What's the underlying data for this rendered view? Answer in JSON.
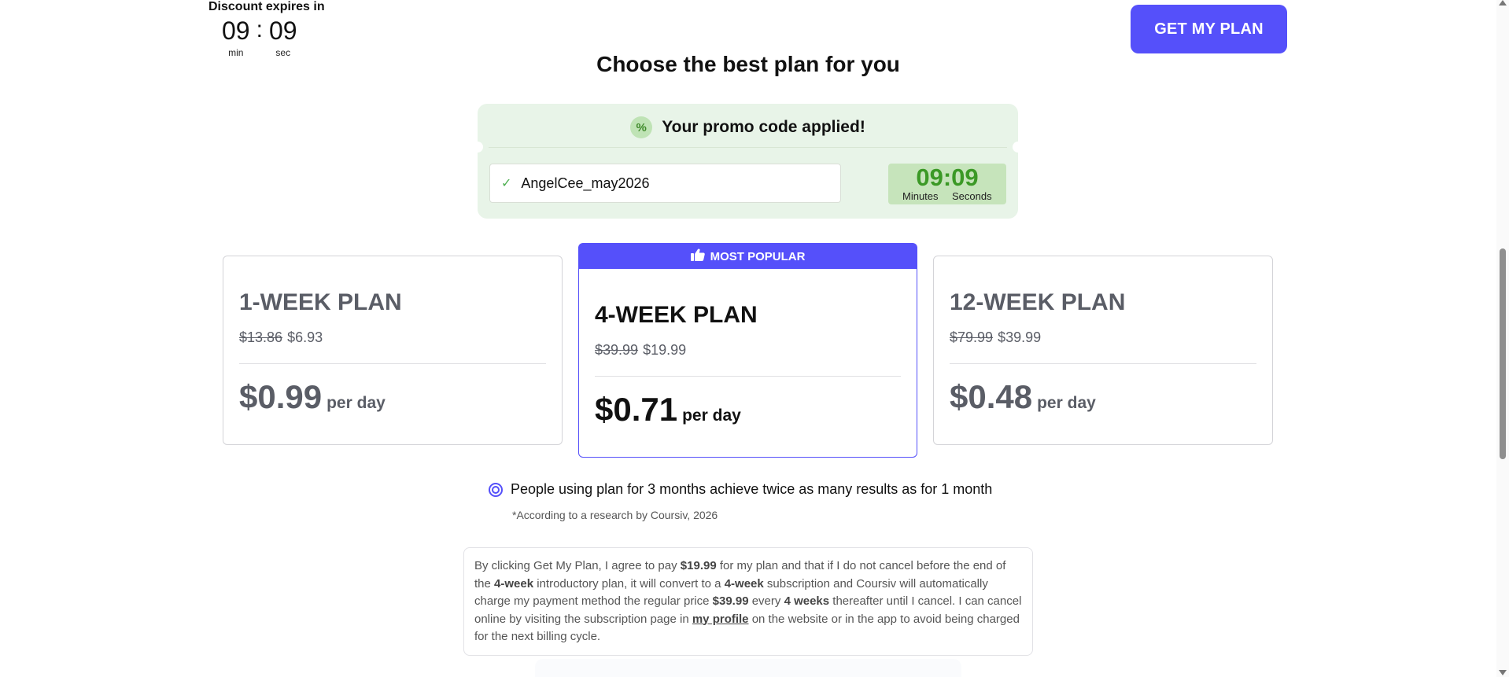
{
  "header": {
    "discount_label": "Discount expires in",
    "timer": {
      "minutes": "09",
      "seconds": "09",
      "min_label": "min",
      "sec_label": "sec",
      "separator": ":"
    },
    "cta_label": "GET MY PLAN",
    "accent_color": "#5550fa"
  },
  "page_title": "Choose the best plan for you",
  "promo": {
    "title": "Your promo code applied!",
    "icon": "percent-icon",
    "code": "AngelCee_may2026",
    "timer_value": "09:09",
    "minutes_label": "Minutes",
    "seconds_label": "Seconds",
    "bg_color": "#e8f4e8",
    "timer_color": "#3b9926"
  },
  "plans": [
    {
      "name": "1-WEEK PLAN",
      "old_price": "$13.86",
      "price": "$6.93",
      "per_day": "$0.99",
      "per_day_label": "per day",
      "popular": false
    },
    {
      "name": "4-WEEK PLAN",
      "old_price": "$39.99",
      "price": "$19.99",
      "per_day": "$0.71",
      "per_day_label": "per day",
      "popular": true,
      "badge": "MOST POPULAR"
    },
    {
      "name": "12-WEEK PLAN",
      "old_price": "$79.99",
      "price": "$39.99",
      "per_day": "$0.48",
      "per_day_label": "per day",
      "popular": false
    }
  ],
  "info": {
    "text": "People using plan for 3 months achieve twice as many results as for 1 month",
    "research": "*According to a research by Coursiv, 2026"
  },
  "terms": {
    "t1": "By clicking Get My Plan, I agree to pay ",
    "b1": "$19.99",
    "t2": " for my plan and that if I do not cancel before the end of the ",
    "b2": "4-week",
    "t3": " introductory plan, it will convert to a ",
    "b3": "4-week",
    "t4": " subscription and Coursiv will automatically charge my payment method the regular price ",
    "b4": "$39.99",
    "t5": " every ",
    "b5": "4 weeks",
    "t6": " thereafter until I cancel. I can cancel online by visiting the subscription page in ",
    "link": "my profile",
    "t7": " on the website or in the app to avoid being charged for the next billing cycle."
  }
}
